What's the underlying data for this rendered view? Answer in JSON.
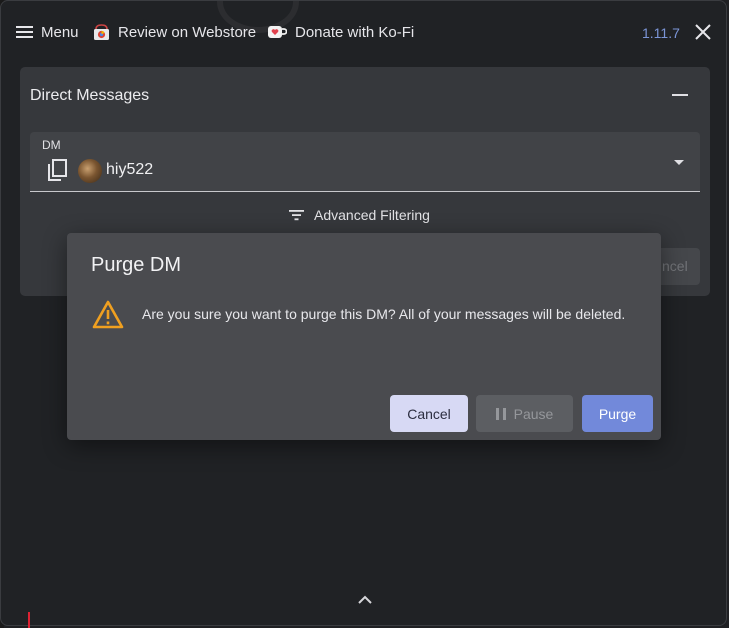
{
  "topbar": {
    "menu_label": "Menu",
    "webstore_label": "Review on Webstore",
    "kofi_label": "Donate with Ko-Fi",
    "version": "1.11.7"
  },
  "panel": {
    "title": "Direct Messages",
    "dm_field": {
      "label": "DM",
      "selected_value": "hiy522"
    },
    "advanced_filtering_label": "Advanced Filtering",
    "obscured_button_label": "ncel"
  },
  "dialog": {
    "title": "Purge DM",
    "message": "Are you sure you want to purge this DM? All of your messages will be deleted.",
    "buttons": {
      "cancel": "Cancel",
      "pause": "Pause",
      "purge": "Purge"
    }
  },
  "colors": {
    "accent": "#7289da",
    "version_text": "#7b95d6",
    "warning": "#f0a020",
    "dialog_bg": "#4a4b4f",
    "panel_bg": "#36383c"
  },
  "icons": [
    "menu-icon",
    "webstore-icon",
    "kofi-icon",
    "close-icon",
    "minimize-icon",
    "copy-icon",
    "avatar",
    "dropdown-caret-icon",
    "filter-icon",
    "warning-icon",
    "pause-icon",
    "chevron-up-icon"
  ]
}
